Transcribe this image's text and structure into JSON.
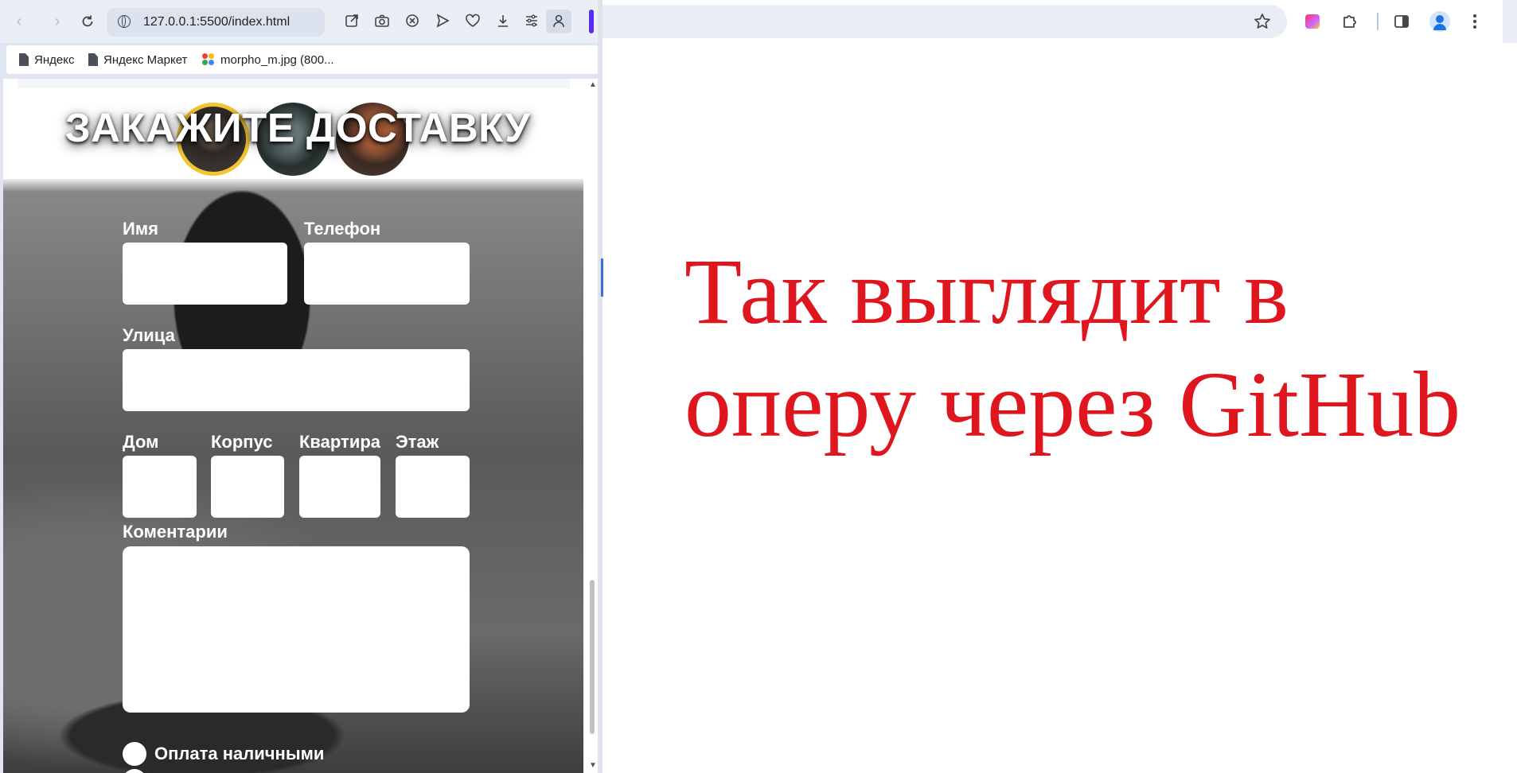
{
  "left_browser": {
    "url": "127.0.0.1:5500/index.html",
    "bookmarks": [
      {
        "label": "Яндекс",
        "icon": "page-icon"
      },
      {
        "label": "Яндекс Маркет",
        "icon": "page-icon"
      },
      {
        "label": "morpho_m.jpg (800...",
        "icon": "image-icon"
      }
    ],
    "accent_color": "#5a2cf2"
  },
  "page": {
    "hero_title": "ЗАКАЖИТЕ ДОСТАВКУ",
    "avatar_ring_color": "#f2c633",
    "form": {
      "name_label": "Имя",
      "phone_label": "Телефон",
      "street_label": "Улица",
      "house_label": "Дом",
      "building_label": "Корпус",
      "apartment_label": "Квартира",
      "floor_label": "Этаж",
      "comments_label": "Коментарии",
      "payment_cash_label": "Оплата наличными"
    }
  },
  "right_browser": {
    "caption": "Так выглядит в оперу через GitHub",
    "caption_color": "#e0161f"
  }
}
